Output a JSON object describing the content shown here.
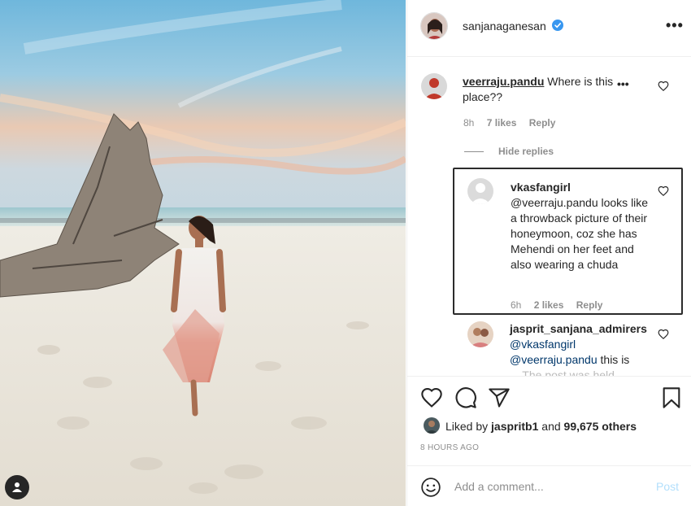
{
  "post": {
    "username": "sanjanaganesan",
    "verified_icon": "verified-badge-icon",
    "more_icon": "more-options-icon",
    "more_label": "•••"
  },
  "comments": [
    {
      "username": "veerraju.pandu",
      "text": "Where is this place??",
      "time": "8h",
      "likes": "7 likes",
      "reply_label": "Reply",
      "more_label": "•••",
      "hide_replies_label": "Hide replies",
      "replies": [
        {
          "username": "vkasfangirl",
          "text": "@veerraju.pandu looks like a throwback picture of their honeymoon, coz she has Mehendi on her feet and also wearing a chuda",
          "time": "6h",
          "likes": "2 likes",
          "reply_label": "Reply"
        },
        {
          "username": "jasprit_sanjana_admirers",
          "mention1": "@vkasfangirl",
          "mention2": "@veerraju.pandu",
          "text": "this is",
          "text_cut": "... The post was held..."
        }
      ]
    }
  ],
  "actions": {
    "like_icon": "heart-outline-icon",
    "comment_icon": "comment-icon",
    "share_icon": "paper-plane-icon",
    "save_icon": "bookmark-icon"
  },
  "likes": {
    "liked_by_prefix": "Liked by",
    "liked_by_user": "jaspritb1",
    "liked_by_suffix": "and",
    "others": "99,675 others"
  },
  "timestamp": "8 HOURS AGO",
  "add_comment": {
    "placeholder": "Add a comment...",
    "post_label": "Post",
    "post_color": "#b2dffc"
  },
  "colors": {
    "verified": "#3897f0",
    "text": "#262626",
    "muted": "#8e8e8e"
  }
}
